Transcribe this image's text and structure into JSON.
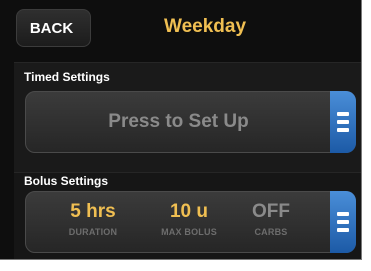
{
  "header": {
    "back_label": "BACK",
    "title": "Weekday"
  },
  "timed_settings": {
    "label": "Timed Settings",
    "prompt": "Press to Set Up"
  },
  "bolus_settings": {
    "label": "Bolus Settings",
    "duration": {
      "value": "5 hrs",
      "label": "DURATION"
    },
    "max_bolus": {
      "value": "10 u",
      "label": "MAX BOLUS"
    },
    "carbs": {
      "value": "OFF",
      "label": "CARBS"
    }
  },
  "colors": {
    "accent": "#f0bf52",
    "menu_handle": "#2f74c4",
    "inactive_value": "#8a8a8a"
  },
  "icons": {
    "menu_handle": "menu-icon"
  }
}
